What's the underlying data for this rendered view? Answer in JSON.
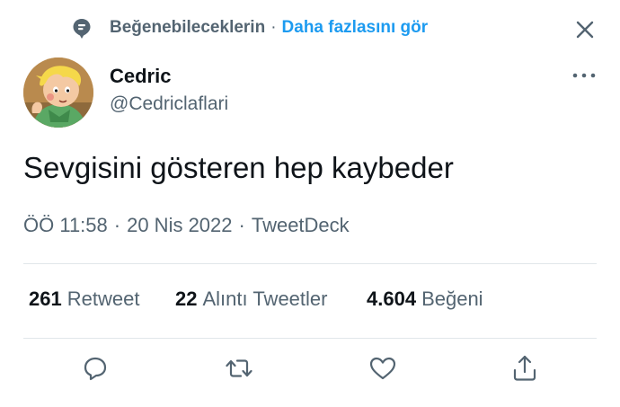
{
  "context": {
    "icon": "topic-pin-icon",
    "label": "Beğenebileceklerin",
    "separator": "·",
    "link": "Daha fazlasını gör",
    "close_icon": "close-icon"
  },
  "author": {
    "name": "Cedric",
    "handle": "@Cedriclaflari",
    "more_icon": "more-dots-icon"
  },
  "tweet": {
    "text": "Sevgisini gösteren hep kaybeder"
  },
  "meta": {
    "time": "ÖÖ 11:58",
    "sep1": "·",
    "date": "20 Nis 2022",
    "sep2": "·",
    "source": "TweetDeck"
  },
  "stats": {
    "retweets": {
      "count": "261",
      "label": "Retweet"
    },
    "quotes": {
      "count": "22",
      "label": "Alıntı Tweetler"
    },
    "likes": {
      "count": "4.604",
      "label": "Beğeni"
    }
  },
  "actions": {
    "reply_icon": "reply-icon",
    "retweet_icon": "retweet-icon",
    "like_icon": "heart-icon",
    "share_icon": "share-icon"
  },
  "colors": {
    "accent": "#1d9bf0",
    "text": "#0f1419",
    "secondary": "#536471",
    "divider": "#e1e6ea"
  }
}
